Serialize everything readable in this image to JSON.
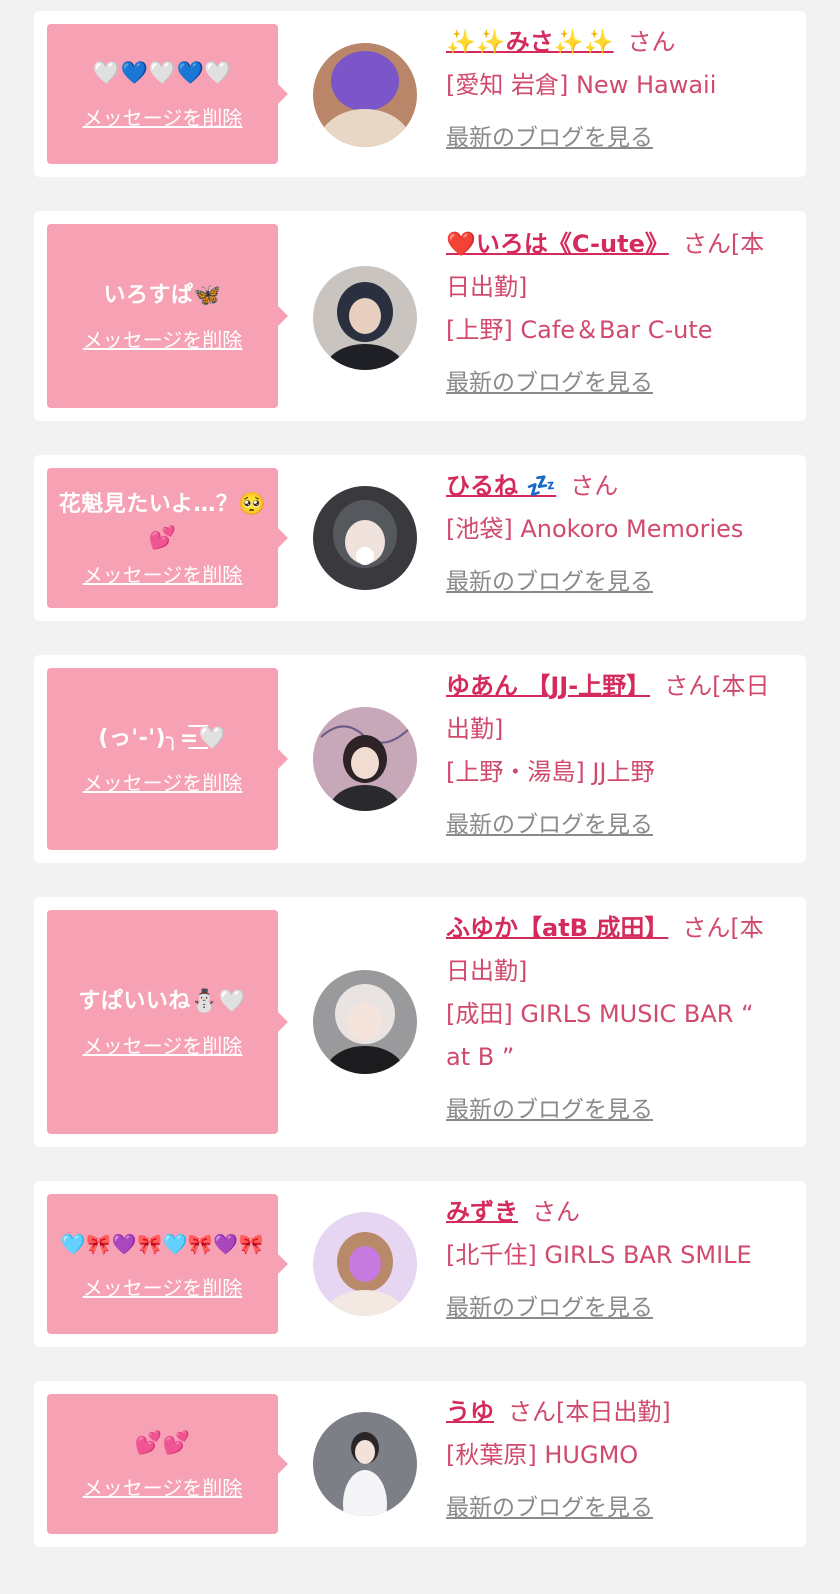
{
  "delete_label": "メッセージを削除",
  "blog_label": "最新のブログを見る",
  "colors": {
    "background": "#f2f2f2",
    "card": "#ffffff",
    "bubble": "#f7a1b4",
    "name": "#d42a5c",
    "text_pink": "#d14a6e",
    "link_gray": "#8a8a8a"
  },
  "entries": [
    {
      "message": "🤍💙🤍💙🤍",
      "name": "✨✨みさ✨✨",
      "suffix": "さん",
      "shop": "[愛知 岩倉] New Hawaii",
      "avatar_icon": "user-photo-icon"
    },
    {
      "message": "いろすぱ🦋",
      "name": "❤️いろは《C-ute》",
      "suffix": "さん[本日出勤]",
      "shop": "[上野] Cafe＆Bar C-ute",
      "avatar_icon": "user-photo-icon"
    },
    {
      "message": "花魁見たいよ…？🥺💕",
      "name": "ひるね 💤",
      "suffix": "さん",
      "shop": "[池袋] Anokoro Memories",
      "avatar_icon": "user-photo-icon"
    },
    {
      "message": "(っ'-')╮=͟͟͞͞🤍",
      "name": "ゆあん 【JJ-上野】",
      "suffix": "さん[本日出勤]",
      "shop": "[上野・湯島] JJ上野",
      "avatar_icon": "user-photo-icon"
    },
    {
      "message": "すぱいいね⛄️🤍",
      "name": "ふゆか【atB 成田】",
      "suffix": "さん[本日出勤]",
      "shop": "[成田] GIRLS MUSIC BAR “ at B ”",
      "avatar_icon": "user-photo-icon"
    },
    {
      "message": "🩵🎀💜🎀🩵🎀💜🎀",
      "name": "みずき",
      "suffix": "さん",
      "shop": "[北千住] GIRLS BAR SMILE",
      "avatar_icon": "user-photo-icon"
    },
    {
      "message": "💕💕",
      "name": "うゆ",
      "suffix": "さん[本日出勤]",
      "shop": "[秋葉原] HUGMO",
      "avatar_icon": "user-photo-icon"
    }
  ]
}
